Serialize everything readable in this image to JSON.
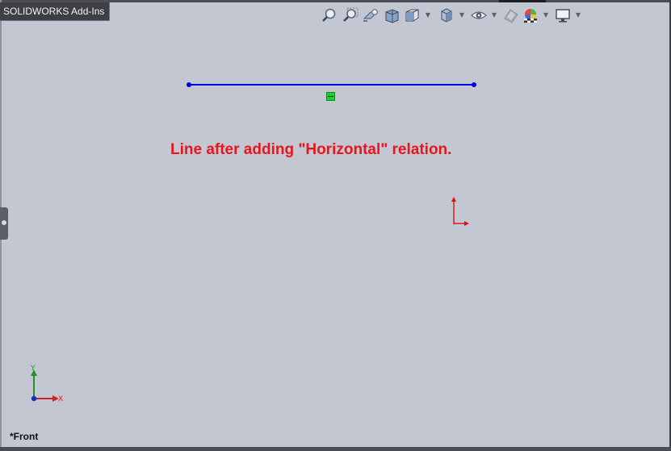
{
  "tabs": {
    "addins_label": "SOLIDWORKS Add-Ins"
  },
  "toolbar": {
    "buttons": [
      {
        "name": "zoom-to-fit"
      },
      {
        "name": "zoom-to-area"
      },
      {
        "name": "previous-view"
      },
      {
        "name": "section-view"
      },
      {
        "name": "view-orientation"
      },
      {
        "name": "display-style"
      },
      {
        "name": "hide-show-items"
      },
      {
        "name": "edit-appearance"
      },
      {
        "name": "apply-scene"
      },
      {
        "name": "view-settings"
      }
    ]
  },
  "sketch": {
    "line_color": "#0000e6",
    "relation": "Horizontal"
  },
  "annotation": {
    "text": "Line after adding \"Horizontal\" relation."
  },
  "triad": {
    "x_label": "X",
    "y_label": "Y"
  },
  "view": {
    "label": "*Front"
  },
  "colors": {
    "background": "#c3c7d1",
    "annotation": "#e8161c",
    "relation_glyph": "#22cc33"
  }
}
